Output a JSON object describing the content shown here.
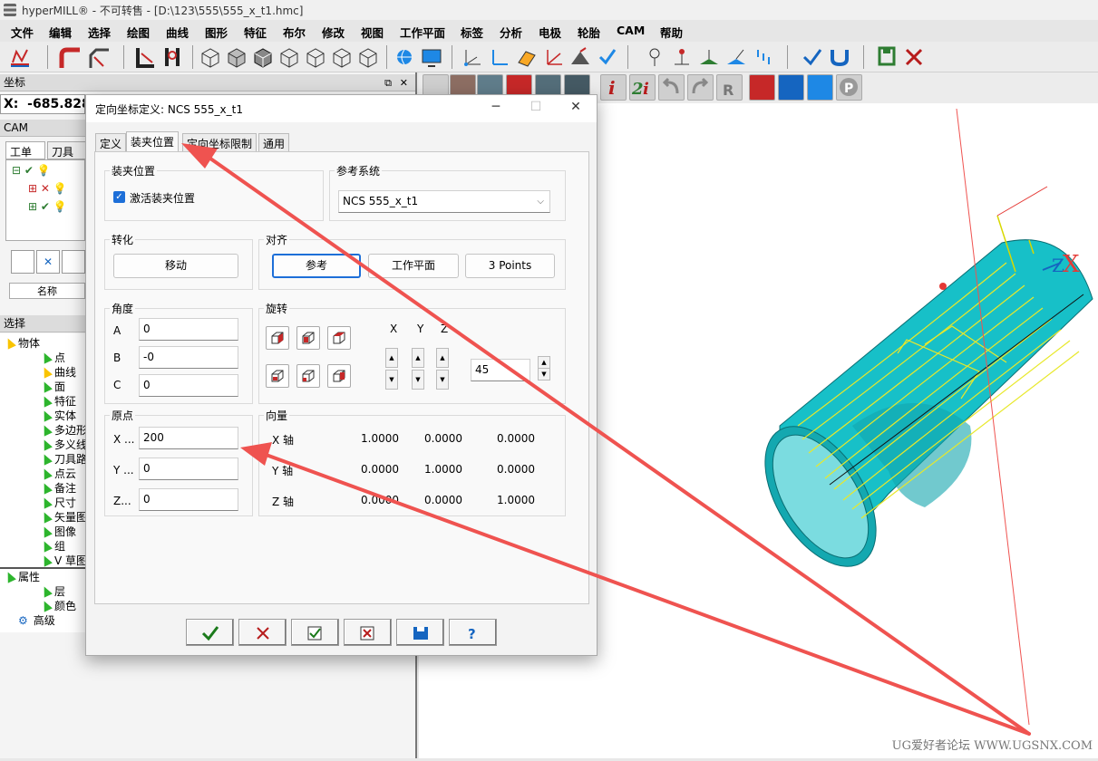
{
  "window": {
    "title": "hyperMILL® - 不可转售 - [D:\\123\\555\\555_x_t1.hmc]"
  },
  "menu": [
    "文件",
    "编辑",
    "选择",
    "绘图",
    "曲线",
    "图形",
    "特征",
    "布尔",
    "修改",
    "视图",
    "工作平面",
    "标签",
    "分析",
    "电极",
    "轮胎",
    "CAM",
    "帮助"
  ],
  "left_panel": {
    "coords_header": "坐标",
    "x_label": "X:",
    "x_value": "-685.828",
    "cam_header": "CAM",
    "cam_tabs": [
      "工单",
      "刀具"
    ],
    "name_col": "名称",
    "select_header": "选择",
    "tree": [
      "物体",
      "点",
      "曲线",
      "面",
      "特征",
      "实体",
      "多边形",
      "多义线",
      "刀具路",
      "点云",
      "备注",
      "尺寸",
      "矢量图",
      "图像",
      "组",
      "V 草图"
    ],
    "tree2": [
      "属性",
      "层",
      "颜色",
      "高级"
    ]
  },
  "dialog": {
    "title": "定向坐标定义:  NCS 555_x_t1",
    "tabs": [
      "定义",
      "装夹位置",
      "定向坐标限制",
      "通用"
    ],
    "clamp_group": "装夹位置",
    "activate_label": "激活装夹位置",
    "activate_checked": true,
    "ref_group": "参考系统",
    "ref_value": "NCS 555_x_t1",
    "transform_group": "转化",
    "move_btn": "移动",
    "align_group": "对齐",
    "align_buttons": [
      "参考",
      "工作平面",
      "3 Points"
    ],
    "angle_group": "角度",
    "angle": {
      "a_label": "A",
      "a": "0",
      "b_label": "B",
      "b": "-0",
      "c_label": "C",
      "c": "0"
    },
    "rotate_group": "旋转",
    "axes": [
      "X",
      "Y",
      "Z"
    ],
    "rot_value": "45",
    "origin_group": "原点",
    "origin": {
      "x_label": "X ...",
      "x": "200",
      "y_label": "Y ...",
      "y": "0",
      "z_label": "Z...",
      "z": "0"
    },
    "vector_group": "向量",
    "vectors": [
      {
        "label": "X 轴",
        "v": [
          "1.0000",
          "0.0000",
          "0.0000"
        ]
      },
      {
        "label": "Y 轴",
        "v": [
          "0.0000",
          "1.0000",
          "0.0000"
        ]
      },
      {
        "label": "Z 轴",
        "v": [
          "0.0000",
          "0.0000",
          "1.0000"
        ]
      }
    ]
  },
  "watermark": "UG爱好者论坛 WWW.UGSNX.COM",
  "colors": {
    "part": "#17c0c8",
    "arrow": "#ef5350",
    "accent": "#1d6fd8"
  }
}
